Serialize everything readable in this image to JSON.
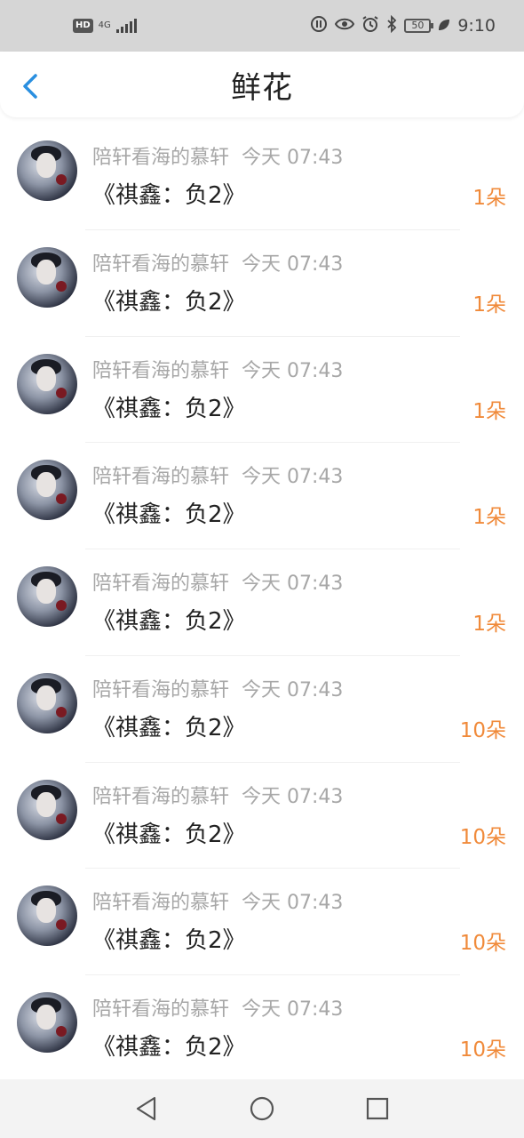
{
  "status_bar": {
    "hd": "HD",
    "network": "4G",
    "battery": "50",
    "time": "9:10",
    "icons": [
      "hd-icon",
      "signal-icon",
      "data-saver-icon",
      "eye-icon",
      "alarm-icon",
      "bluetooth-icon",
      "battery-icon",
      "leaf-icon"
    ]
  },
  "header": {
    "title": "鲜花"
  },
  "items": [
    {
      "user": "陪轩看海的慕轩",
      "time": "今天 07:43",
      "book": "《祺鑫：负2》",
      "count": "1朵"
    },
    {
      "user": "陪轩看海的慕轩",
      "time": "今天 07:43",
      "book": "《祺鑫：负2》",
      "count": "1朵"
    },
    {
      "user": "陪轩看海的慕轩",
      "time": "今天 07:43",
      "book": "《祺鑫：负2》",
      "count": "1朵"
    },
    {
      "user": "陪轩看海的慕轩",
      "time": "今天 07:43",
      "book": "《祺鑫：负2》",
      "count": "1朵"
    },
    {
      "user": "陪轩看海的慕轩",
      "time": "今天 07:43",
      "book": "《祺鑫：负2》",
      "count": "1朵"
    },
    {
      "user": "陪轩看海的慕轩",
      "time": "今天 07:43",
      "book": "《祺鑫：负2》",
      "count": "10朵"
    },
    {
      "user": "陪轩看海的慕轩",
      "time": "今天 07:43",
      "book": "《祺鑫：负2》",
      "count": "10朵"
    },
    {
      "user": "陪轩看海的慕轩",
      "time": "今天 07:43",
      "book": "《祺鑫：负2》",
      "count": "10朵"
    },
    {
      "user": "陪轩看海的慕轩",
      "time": "今天 07:43",
      "book": "《祺鑫：负2》",
      "count": "10朵"
    }
  ],
  "colors": {
    "accent": "#2a8fe0",
    "count": "#f08a3a",
    "muted": "#a7a7a7"
  }
}
